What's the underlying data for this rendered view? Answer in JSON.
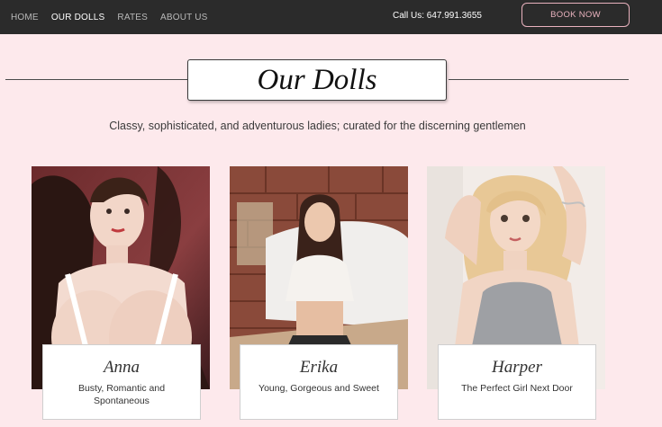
{
  "nav": {
    "items": [
      "HOME",
      "OUR DOLLS",
      "RATES",
      "ABOUT US"
    ],
    "active_index": 1,
    "phone": "Call Us: 647.991.3655",
    "book_label": "BOOK NOW"
  },
  "page": {
    "title": "Our Dolls",
    "tagline": "Classy, sophisticated, and adventurous ladies; curated for the discerning gentlemen"
  },
  "dolls": [
    {
      "name": "Anna",
      "desc": "Busty, Romantic and Spontaneous"
    },
    {
      "name": "Erika",
      "desc": "Young, Gorgeous and Sweet"
    },
    {
      "name": "Harper",
      "desc": "The Perfect Girl Next Door"
    }
  ],
  "colors": {
    "background": "#fde9ec",
    "topbar": "#2b2b2b",
    "accent": "#e9b2be"
  }
}
